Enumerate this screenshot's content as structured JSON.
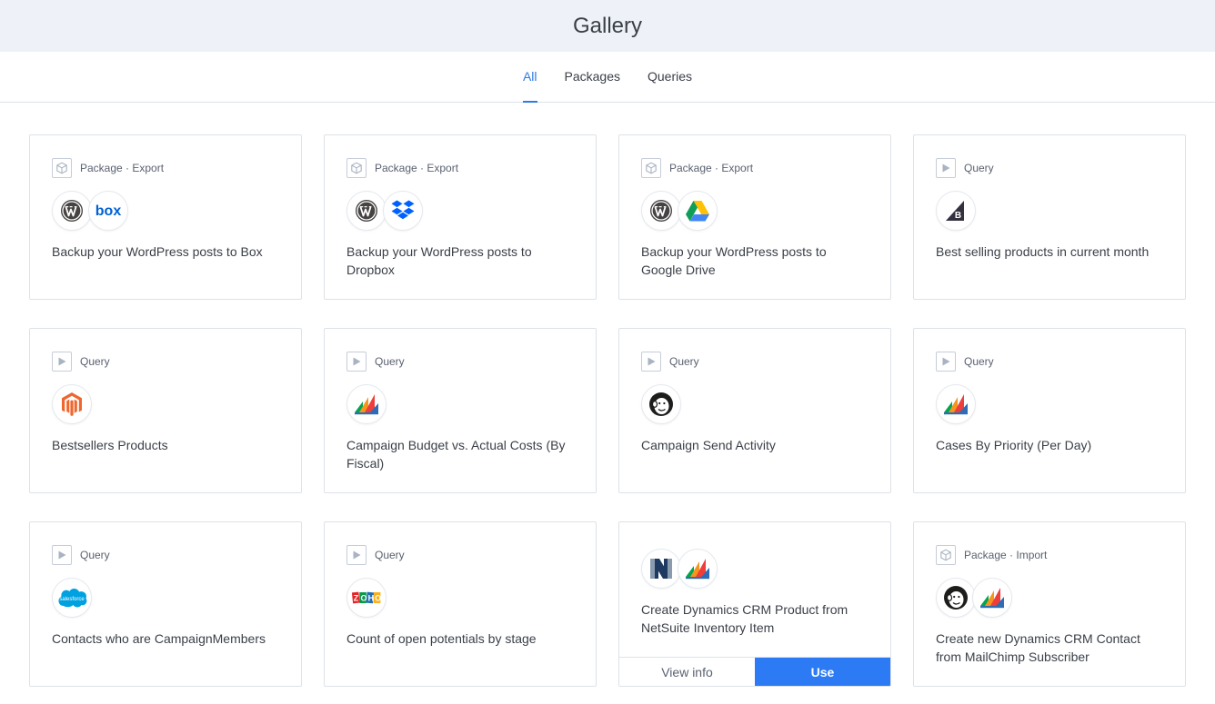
{
  "header": {
    "title": "Gallery"
  },
  "tabs": [
    {
      "label": "All",
      "active": true
    },
    {
      "label": "Packages",
      "active": false
    },
    {
      "label": "Queries",
      "active": false
    }
  ],
  "cards": [
    {
      "type_icon": "package-icon",
      "meta": "Package · Export",
      "logos": [
        "wordpress-logo",
        "box-logo"
      ],
      "title": "Backup your WordPress posts to Box"
    },
    {
      "type_icon": "package-icon",
      "meta": "Package · Export",
      "logos": [
        "wordpress-logo",
        "dropbox-logo"
      ],
      "title": "Backup your WordPress posts to Dropbox"
    },
    {
      "type_icon": "package-icon",
      "meta": "Package · Export",
      "logos": [
        "wordpress-logo",
        "google-drive-logo"
      ],
      "title": "Backup your WordPress posts to Google Drive"
    },
    {
      "type_icon": "query-icon",
      "meta": "Query",
      "logos": [
        "bigcommerce-logo"
      ],
      "title": "Best selling products in current month"
    },
    {
      "type_icon": "query-icon",
      "meta": "Query",
      "logos": [
        "magento-logo"
      ],
      "title": "Bestsellers Products"
    },
    {
      "type_icon": "query-icon",
      "meta": "Query",
      "logos": [
        "dynamics-crm-logo"
      ],
      "title": "Campaign Budget vs. Actual Costs (By Fiscal)"
    },
    {
      "type_icon": "query-icon",
      "meta": "Query",
      "logos": [
        "mailchimp-logo"
      ],
      "title": "Campaign Send Activity"
    },
    {
      "type_icon": "query-icon",
      "meta": "Query",
      "logos": [
        "dynamics-crm-logo"
      ],
      "title": "Cases By Priority (Per Day)"
    },
    {
      "type_icon": "query-icon",
      "meta": "Query",
      "logos": [
        "salesforce-logo"
      ],
      "title": "Contacts who are CampaignMembers"
    },
    {
      "type_icon": "query-icon",
      "meta": "Query",
      "logos": [
        "zoho-logo"
      ],
      "title": "Count of open potentials by stage"
    },
    {
      "type_icon": "package-icon",
      "meta": "",
      "logos": [
        "netsuite-logo",
        "dynamics-crm-logo"
      ],
      "title": "Create Dynamics CRM Product from NetSuite Inventory Item",
      "hovered": true,
      "view_label": "View info",
      "use_label": "Use"
    },
    {
      "type_icon": "package-icon",
      "meta": "Package · Import",
      "logos": [
        "mailchimp-logo",
        "dynamics-crm-logo"
      ],
      "title": "Create new Dynamics CRM Contact from MailChimp Subscriber"
    }
  ],
  "logo_text": {
    "box": "box",
    "salesforce": "salesforce",
    "zoho": "ZOHO"
  },
  "colors": {
    "accent": "#2d7be5",
    "use_button": "#2d7bf4",
    "header_bg": "#eef2f8",
    "border": "#dde2e8"
  }
}
